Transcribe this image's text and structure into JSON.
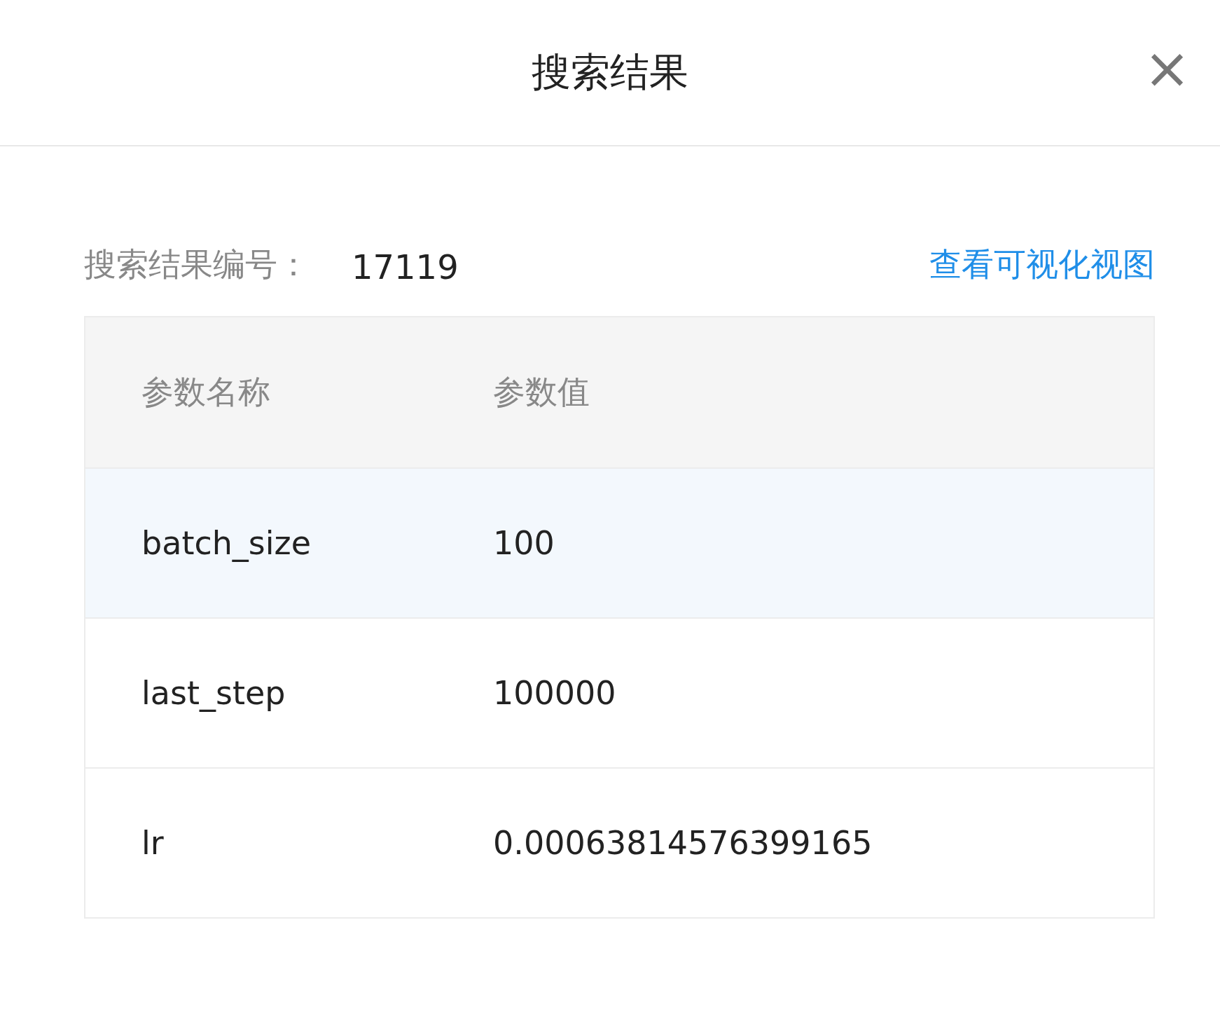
{
  "dialog": {
    "title": "搜索结果",
    "close": "×"
  },
  "result": {
    "label": "搜索结果编号：",
    "value": "17119",
    "link": "查看可视化视图"
  },
  "table": {
    "columns": [
      "参数名称",
      "参数值"
    ],
    "rows": [
      {
        "cells": [
          "batch_size",
          "100"
        ],
        "highlighted": true
      },
      {
        "cells": [
          "last_step",
          "100000"
        ],
        "highlighted": false
      },
      {
        "cells": [
          "lr",
          "0.00063814576399165"
        ],
        "highlighted": false
      }
    ]
  }
}
